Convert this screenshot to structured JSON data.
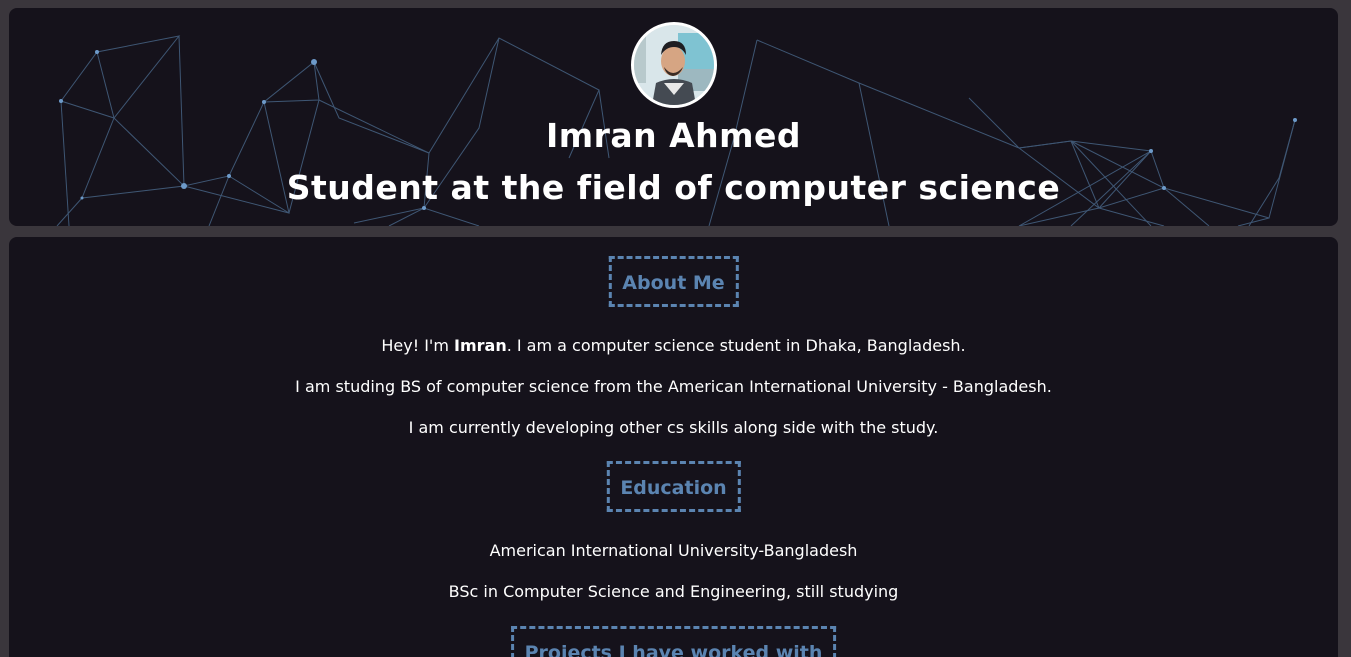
{
  "header": {
    "name": "Imran Ahmed",
    "role": "Student at the field of computer science",
    "avatar_icon": "cartoon-portrait-avatar"
  },
  "about": {
    "title": "About Me",
    "line1_prefix": "Hey! I'm ",
    "line1_name": "Imran",
    "line1_suffix": ". I am a computer science student in Dhaka, Bangladesh.",
    "line2": "I am studing BS of computer science from the American International University - Bangladesh.",
    "line3": "I am currently developing other cs skills along side with the study."
  },
  "education": {
    "title": "Education",
    "institution": "American International University-Bangladesh",
    "degree": "BSc in Computer Science and Engineering, still studying"
  },
  "projects": {
    "title": "Projects I have worked with"
  },
  "colors": {
    "page_bg": "#3a363c",
    "card_bg": "#15121b",
    "accent": "#5b84b1",
    "text": "#ffffff"
  }
}
